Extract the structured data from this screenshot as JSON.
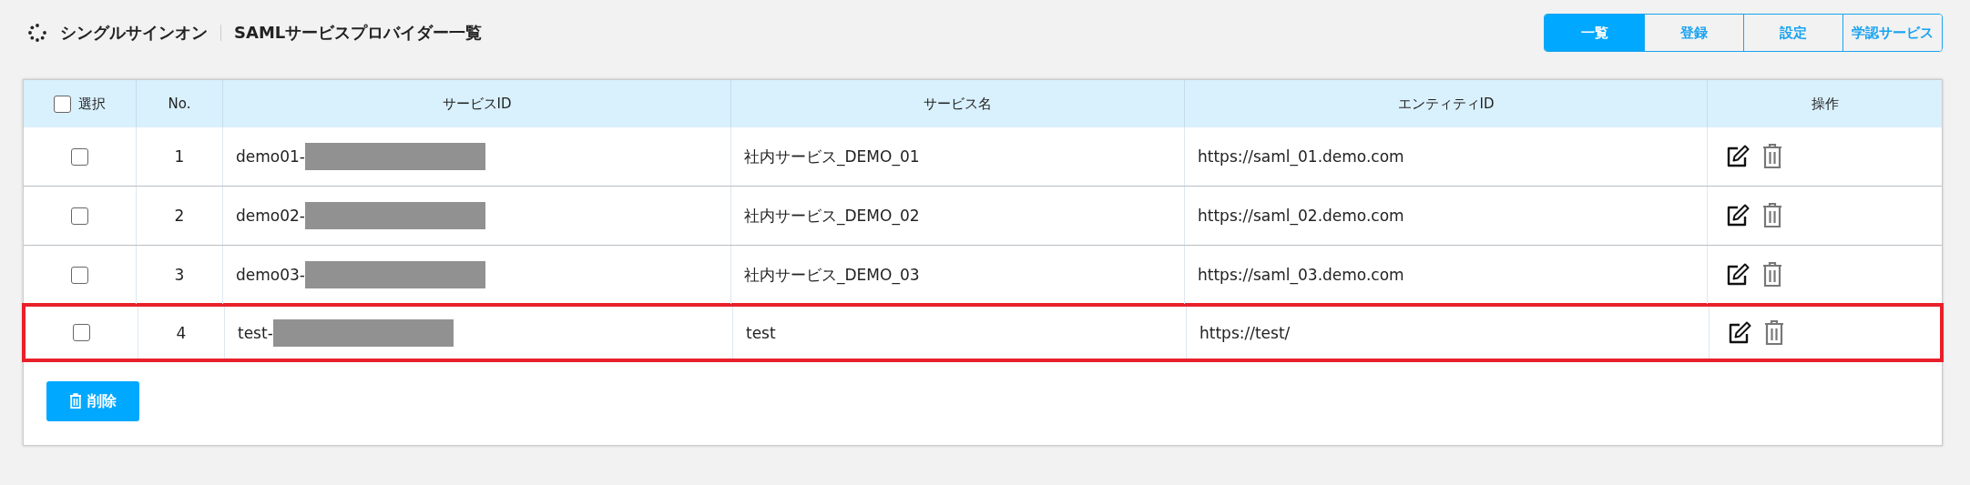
{
  "header": {
    "app_title": "シングルサインオン",
    "page_title": "SAMLサービスプロバイダー一覧"
  },
  "tabs": [
    {
      "label": "一覧",
      "selected": true
    },
    {
      "label": "登録",
      "selected": false
    },
    {
      "label": "設定",
      "selected": false
    },
    {
      "label": "学認サービス",
      "selected": false
    }
  ],
  "table": {
    "select_all": {
      "label": "選択",
      "checked": false
    },
    "columns": [
      "No.",
      "サービスID",
      "サービス名",
      "エンティティID",
      "操作"
    ],
    "rows": [
      {
        "checked": false,
        "no": "1",
        "service_id": "demo01-",
        "redacted": true,
        "service_name": "社内サービス_DEMO_01",
        "entity_id": "https://saml_01.demo.com",
        "highlighted": false
      },
      {
        "checked": false,
        "no": "2",
        "service_id": "demo02-",
        "redacted": true,
        "service_name": "社内サービス_DEMO_02",
        "entity_id": "https://saml_02.demo.com",
        "highlighted": false
      },
      {
        "checked": false,
        "no": "3",
        "service_id": "demo03-",
        "redacted": true,
        "service_name": "社内サービス_DEMO_03",
        "entity_id": "https://saml_03.demo.com",
        "highlighted": false
      },
      {
        "checked": false,
        "no": "4",
        "service_id": "test-",
        "redacted": true,
        "service_name": "test",
        "entity_id": "https://test/",
        "highlighted": true
      }
    ]
  },
  "delete_button": {
    "label": "削除"
  }
}
